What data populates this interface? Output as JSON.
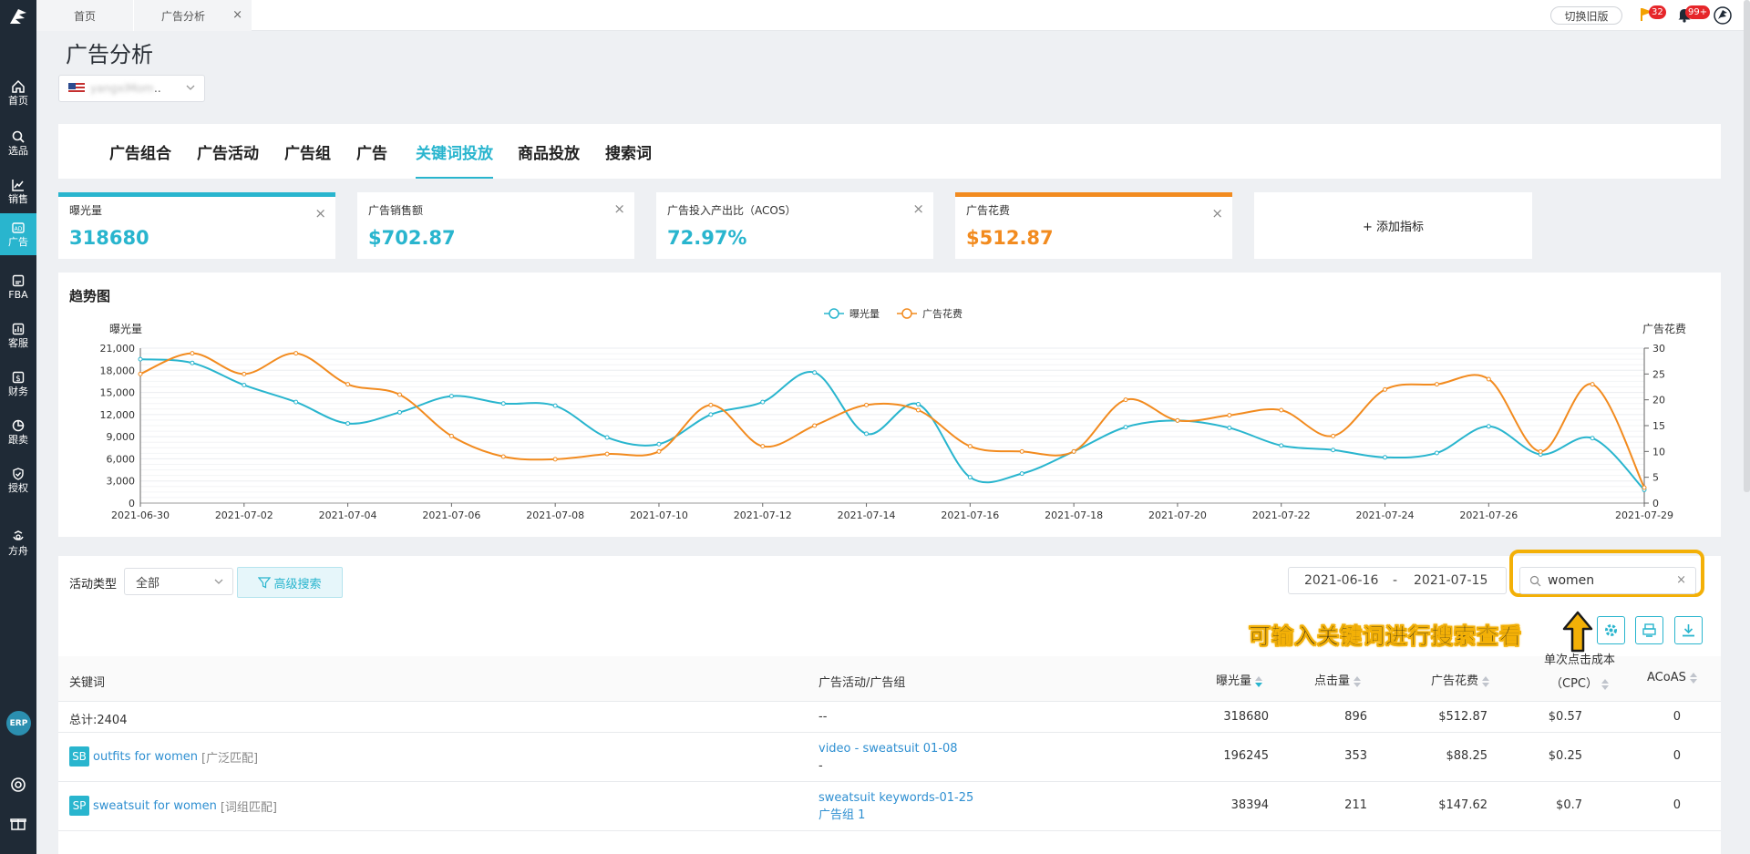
{
  "sidebar": {
    "items": [
      {
        "label": "首页",
        "icon": "home-icon"
      },
      {
        "label": "选品",
        "icon": "search-icon"
      },
      {
        "label": "销售",
        "icon": "chart-line-icon"
      },
      {
        "label": "广告",
        "icon": "ad-icon"
      },
      {
        "label": "FBA",
        "icon": "box-icon"
      },
      {
        "label": "客服",
        "icon": "service-icon"
      },
      {
        "label": "财务",
        "icon": "finance-icon"
      },
      {
        "label": "跟卖",
        "icon": "pie-icon"
      },
      {
        "label": "授权",
        "icon": "shield-icon"
      },
      {
        "label": "方舟",
        "icon": "ark-icon"
      }
    ],
    "erp_label": "ERP"
  },
  "topbar": {
    "tabs": [
      {
        "label": "首页"
      },
      {
        "label": "广告分析"
      }
    ],
    "close_glyph": "×",
    "old_version_label": "切换旧版",
    "flag_badge": "32",
    "bell_badge": "99+"
  },
  "page": {
    "title": "广告分析",
    "store_name": "yangxiMom",
    "store_suffix": ".."
  },
  "nav_tabs": [
    "广告组合",
    "广告活动",
    "广告组",
    "广告",
    "关键词投放",
    "商品投放",
    "搜索词"
  ],
  "metrics": [
    {
      "label": "曝光量",
      "value": "318680"
    },
    {
      "label": "广告销售额",
      "value": "$702.87"
    },
    {
      "label": "广告投入产出比（ACOS）",
      "value": "72.97%"
    },
    {
      "label": "广告花费",
      "value": "$512.87"
    }
  ],
  "add_metric_label": "+ 添加指标",
  "colors": {
    "teal": "#29b5ce",
    "orange": "#f28b1f",
    "highlight": "#f3b007"
  },
  "chart_data": {
    "type": "line",
    "title": "趋势图",
    "x": [
      "2021-06-30",
      "2021-07-01",
      "2021-07-02",
      "2021-07-03",
      "2021-07-04",
      "2021-07-05",
      "2021-07-06",
      "2021-07-07",
      "2021-07-08",
      "2021-07-09",
      "2021-07-10",
      "2021-07-11",
      "2021-07-12",
      "2021-07-13",
      "2021-07-14",
      "2021-07-15",
      "2021-07-16",
      "2021-07-17",
      "2021-07-18",
      "2021-07-19",
      "2021-07-20",
      "2021-07-21",
      "2021-07-22",
      "2021-07-23",
      "2021-07-24",
      "2021-07-25",
      "2021-07-26",
      "2021-07-27",
      "2021-07-28",
      "2021-07-29"
    ],
    "x_tick_labels": [
      "2021-06-30",
      "2021-07-02",
      "2021-07-04",
      "2021-07-06",
      "2021-07-08",
      "2021-07-10",
      "2021-07-12",
      "2021-07-14",
      "2021-07-16",
      "2021-07-18",
      "2021-07-20",
      "2021-07-22",
      "2021-07-24",
      "2021-07-26",
      "2021-07-29"
    ],
    "series": [
      {
        "name": "曝光量",
        "axis": "left",
        "color": "#29b5ce",
        "values": [
          19500,
          19000,
          16000,
          13700,
          10800,
          12300,
          14500,
          13500,
          13200,
          8900,
          8000,
          12000,
          13700,
          17700,
          9400,
          13400,
          3500,
          4000,
          7000,
          10300,
          11200,
          10200,
          7800,
          7200,
          6200,
          6800,
          10400,
          6600,
          8800,
          1800
        ]
      },
      {
        "name": "广告花费",
        "axis": "right",
        "color": "#f28b1f",
        "values": [
          25,
          29,
          25,
          29,
          23,
          21,
          13,
          9,
          8.5,
          9.5,
          10,
          19,
          11,
          15,
          19,
          18,
          11,
          10,
          10,
          20,
          16,
          17,
          18,
          13,
          22,
          23,
          24,
          10,
          23,
          3
        ]
      }
    ],
    "ylabel_left": "曝光量",
    "ylabel_right": "广告花费",
    "y_left_ticks": [
      "0",
      "3,000",
      "6,000",
      "9,000",
      "12,000",
      "15,000",
      "18,000",
      "21,000"
    ],
    "y_right_ticks": [
      "0",
      "5",
      "10",
      "15",
      "20",
      "25",
      "30"
    ],
    "ylim_left": [
      0,
      21000
    ],
    "ylim_right": [
      0,
      30
    ],
    "legend_position": "top-center",
    "grid": true
  },
  "filters": {
    "activity_type_label": "活动类型",
    "activity_type_value": "全部",
    "advanced_search_label": "高级搜索",
    "date_start": "2021-06-16",
    "date_sep": "-",
    "date_end": "2021-07-15",
    "search_value": "women",
    "annotation": "可输入关键词进行搜索查看"
  },
  "table": {
    "headers": {
      "keyword": "关键词",
      "campaign": "广告活动/广告组",
      "impressions": "曝光量",
      "clicks": "点击量",
      "spend": "广告花费",
      "cpc_line1": "单次点击成本",
      "cpc_line2": "（CPC）",
      "acoas": "ACoAS"
    },
    "total": {
      "label": "总计:2404",
      "campaign": "--",
      "impressions": "318680",
      "clicks": "896",
      "spend": "$512.87",
      "cpc": "$0.57",
      "acoas": "0"
    },
    "rows": [
      {
        "tag": "SB",
        "keyword": "outfits for women",
        "match": "[广泛匹配]",
        "campaign": "video - sweatsuit 01-08",
        "group": "-",
        "impressions": "196245",
        "clicks": "353",
        "spend": "$88.25",
        "cpc": "$0.25",
        "acoas": "0"
      },
      {
        "tag": "SP",
        "keyword": "sweatsuit for women",
        "match": "[词组匹配]",
        "campaign": "sweatsuit keywords-01-25",
        "group": "广告组 1",
        "impressions": "38394",
        "clicks": "211",
        "spend": "$147.62",
        "cpc": "$0.7",
        "acoas": "0"
      }
    ]
  }
}
